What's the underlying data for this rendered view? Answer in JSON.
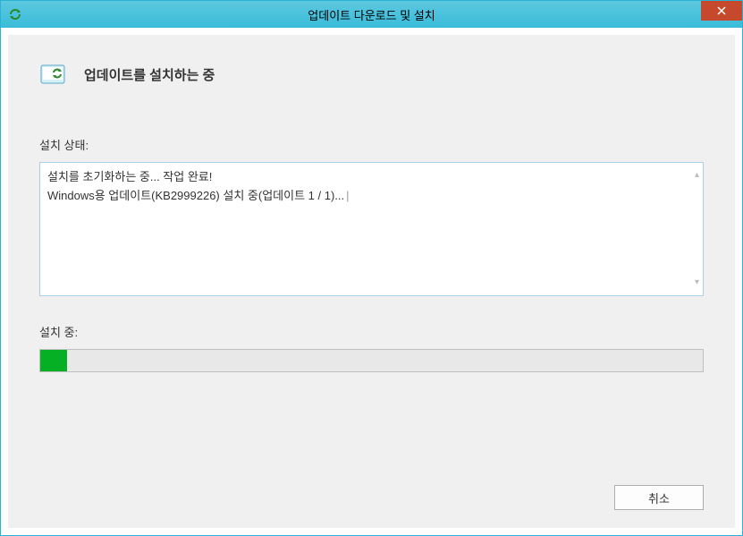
{
  "window": {
    "title": "업데이트 다운로드 및 설치"
  },
  "header": {
    "text": "업데이트를 설치하는 중"
  },
  "status": {
    "label": "설치 상태:",
    "line1": "설치를 초기화하는 중... 작업 완료!",
    "line2": "Windows용 업데이트(KB2999226) 설치 중(업데이트 1 / 1)..."
  },
  "progress": {
    "label": "설치 중:",
    "percent": 4
  },
  "buttons": {
    "cancel": "취소"
  }
}
